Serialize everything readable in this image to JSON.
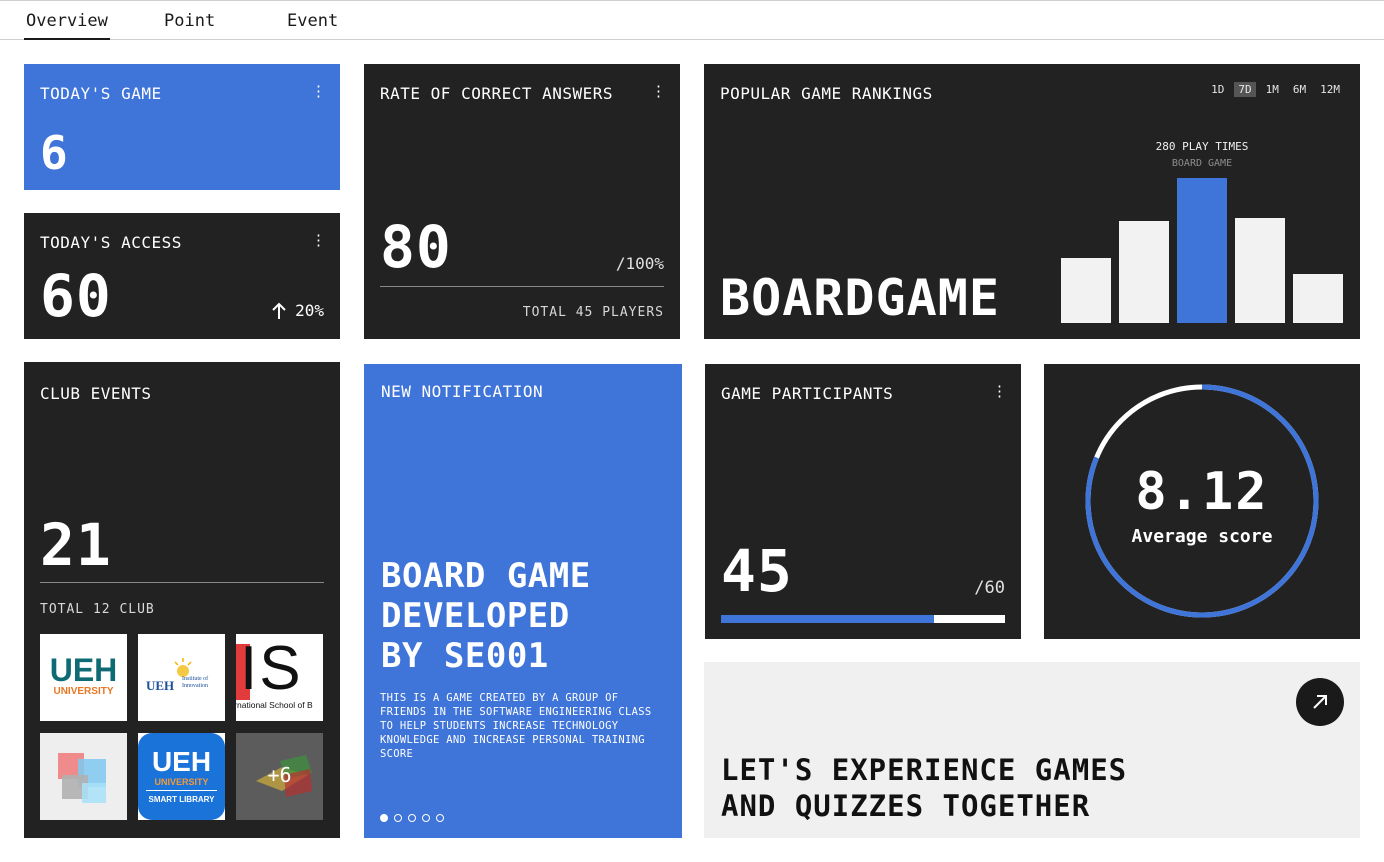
{
  "tabs": [
    {
      "label": "Overview",
      "active": true
    },
    {
      "label": "Point",
      "active": false
    },
    {
      "label": "Event",
      "active": false
    }
  ],
  "todays_game": {
    "title": "TODAY'S GAME",
    "value": "6"
  },
  "todays_access": {
    "title": "TODAY'S ACCESS",
    "value": "60",
    "change": "20%"
  },
  "correct_rate": {
    "title": "RATE OF CORRECT ANSWERS",
    "value": "80",
    "max": "/100%",
    "total": "TOTAL 45 PLAYERS"
  },
  "rankings": {
    "title": "POPULAR GAME RANKINGS",
    "periods": [
      "1D",
      "7D",
      "1M",
      "6M",
      "12M"
    ],
    "active_period": "7D",
    "headline": "BOARDGAME",
    "highlight_label": "280 PLAY TIMES",
    "highlight_category": "BOARD GAME"
  },
  "chart_data": {
    "type": "bar",
    "values": [
      65,
      102,
      145,
      105,
      49
    ],
    "highlight_index": 2
  },
  "club_events": {
    "title": "CLUB EVENTS",
    "value": "21",
    "total": "TOTAL 12 CLUB",
    "more": "+6",
    "logos": [
      {
        "line1": "UEH",
        "line2": "UNIVERSITY"
      },
      {
        "line1": "UEH",
        "line2": "Institute of Innovation"
      },
      {
        "line1": "IS",
        "line2": "International School of B"
      },
      {
        "line1": "",
        "line2": ""
      },
      {
        "line1": "UEH",
        "line2": "UNIVERSITY",
        "line3": "SMART LIBRARY"
      }
    ]
  },
  "notification": {
    "title": "NEW NOTIFICATION",
    "headline_lines": [
      "BOARD GAME",
      "DEVELOPED",
      "BY SE001"
    ],
    "body": "THIS IS A GAME CREATED BY A GROUP OF FRIENDS IN THE SOFTWARE ENGINEERING CLASS TO HELP STUDENTS INCREASE TECHNOLOGY KNOWLEDGE AND INCREASE PERSONAL TRAINING SCORE",
    "slides": 5,
    "active_slide": 0
  },
  "participants": {
    "title": "GAME PARTICIPANTS",
    "value": "45",
    "max": "/60",
    "progress": 0.75
  },
  "average": {
    "value": "8.12",
    "label": "Average score",
    "fraction": 0.812
  },
  "cta": {
    "lines": [
      "LET'S EXPERIENCE GAMES",
      "AND QUIZZES TOGETHER"
    ]
  },
  "colors": {
    "accent": "#3f74d9",
    "card": "#222222",
    "light": "#f0f0f0"
  },
  "icons": {
    "kebab": "kebab-menu-icon",
    "up": "arrow-up-icon",
    "cta": "arrow-up-right-icon"
  }
}
